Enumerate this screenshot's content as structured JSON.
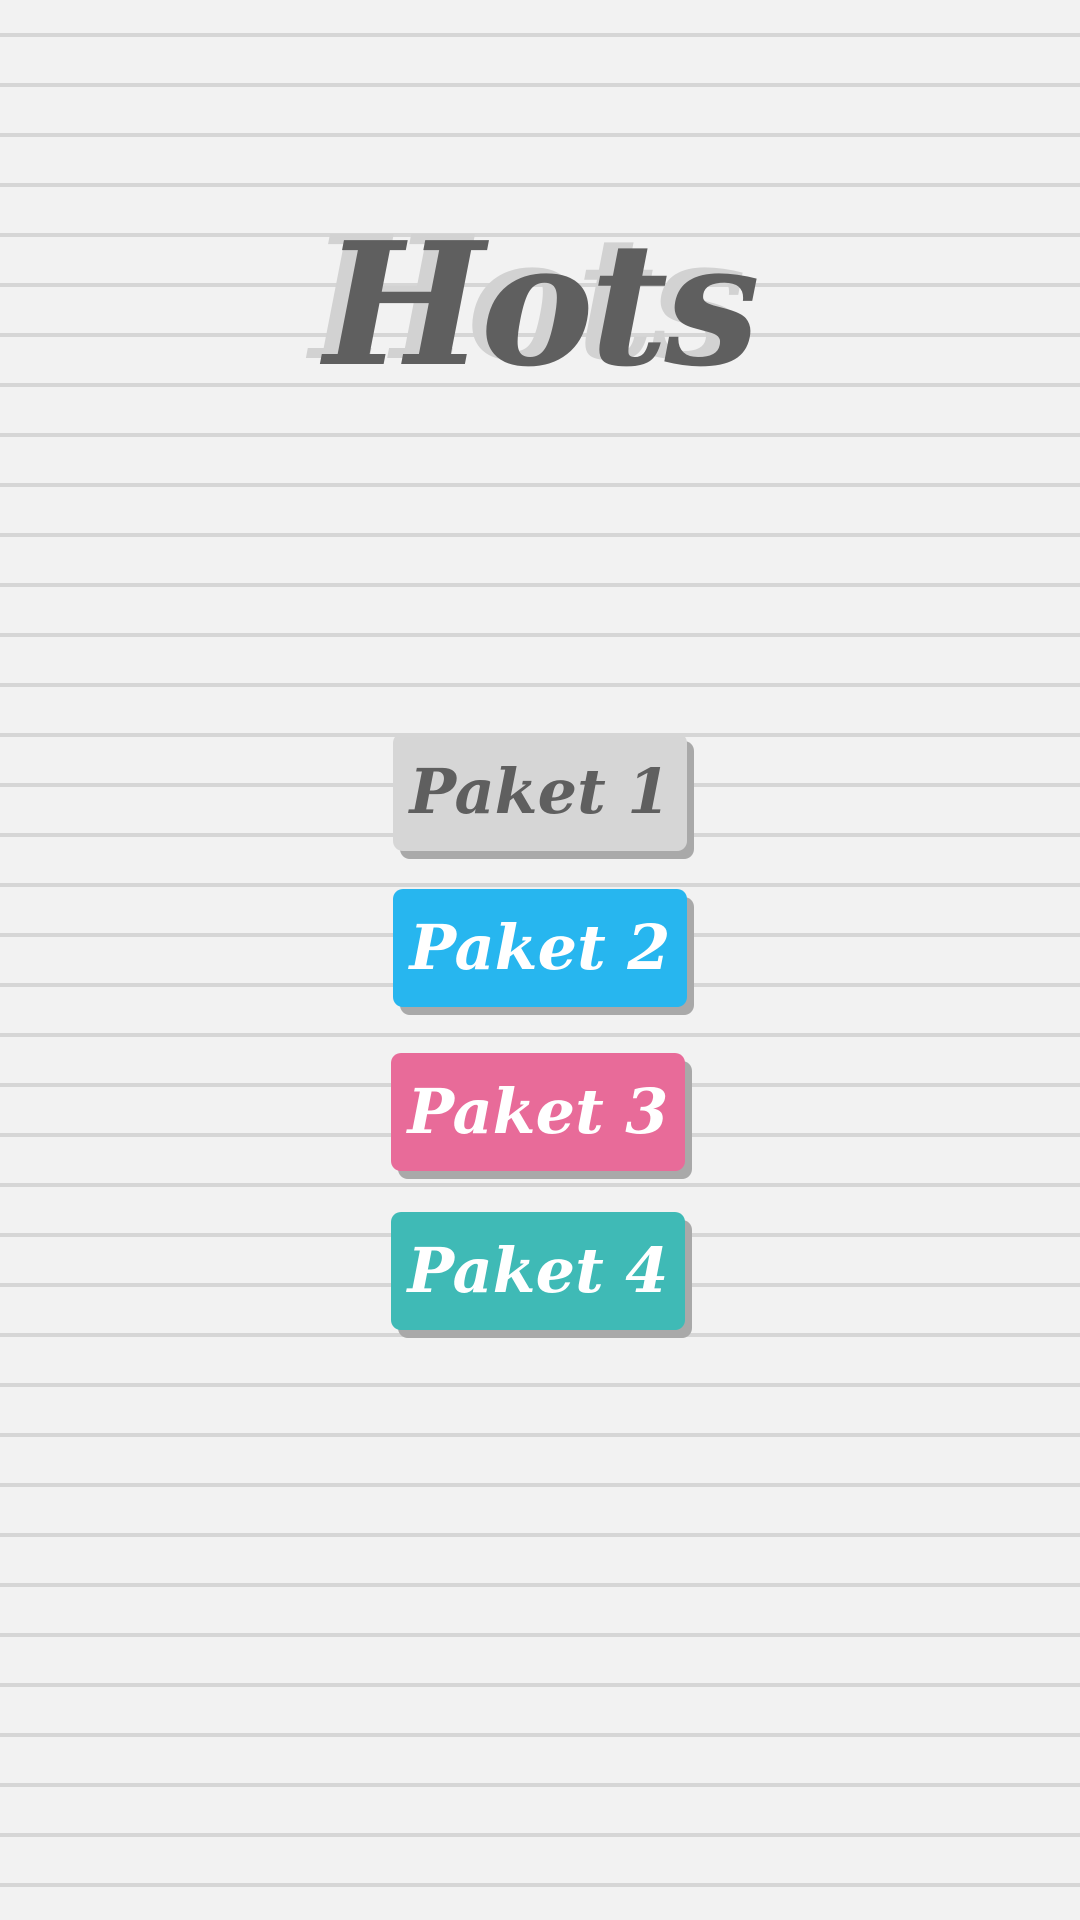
{
  "title": "Hots",
  "buttons": [
    {
      "label": "Paket 1",
      "color": "#d6d6d6",
      "text_color": "#5f5f5f"
    },
    {
      "label": "Paket 2",
      "color": "#27b6ef",
      "text_color": "#ffffff"
    },
    {
      "label": "Paket 3",
      "color": "#e86b99",
      "text_color": "#ffffff"
    },
    {
      "label": "Paket 4",
      "color": "#3fbab6",
      "text_color": "#ffffff"
    }
  ],
  "colors": {
    "background": "#f2f2f2",
    "ruled_line": "#d6d6d6",
    "title": "#5f5f5f",
    "title_shadow": "#d2d2d2",
    "button_shadow": "#a9a9a9"
  }
}
